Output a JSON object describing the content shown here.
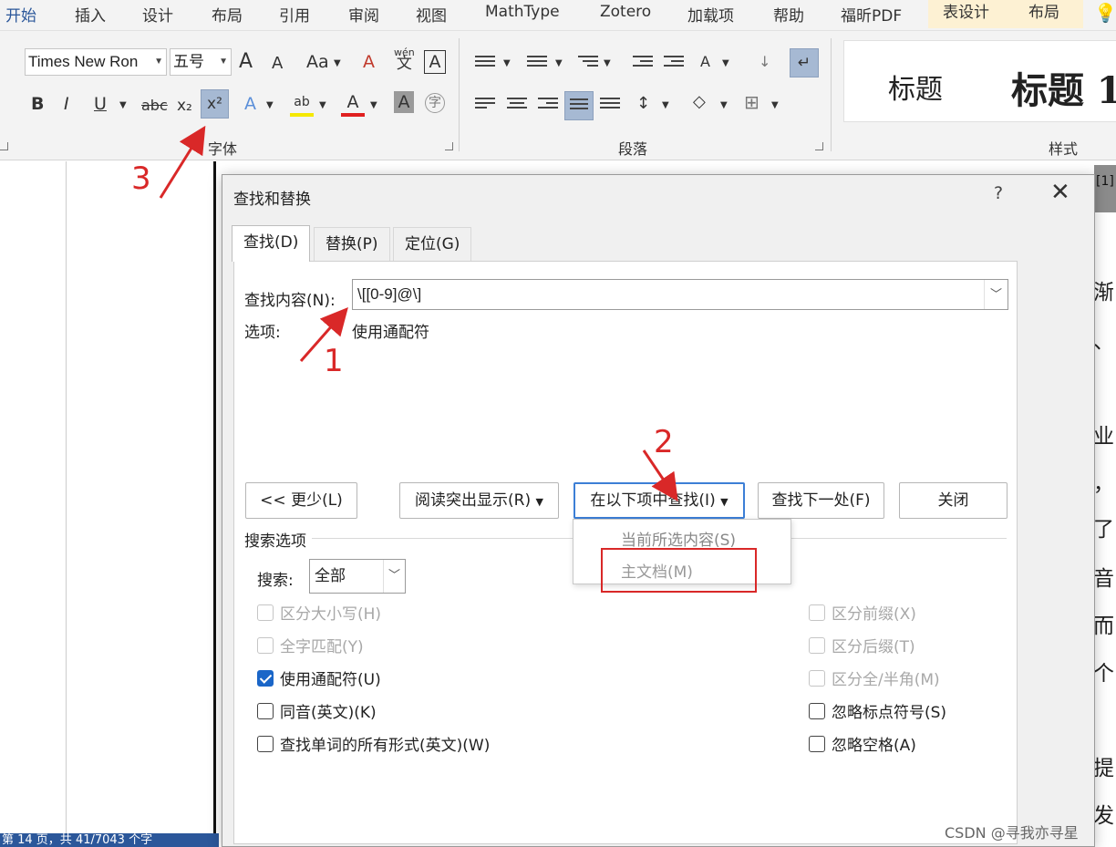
{
  "ribbon": {
    "tabs": [
      "开始",
      "插入",
      "设计",
      "布局",
      "引用",
      "审阅",
      "视图",
      "MathType",
      "Zotero",
      "加载项",
      "帮助",
      "福昕PDF",
      "表设计",
      "布局"
    ],
    "font_name": "Times New Ron",
    "font_size": "五号",
    "group_font": "字体",
    "group_paragraph": "段落",
    "group_styles": "样式",
    "styles": [
      "标题",
      "标题 1"
    ],
    "font_buttons": {
      "bold": "B",
      "italic": "I",
      "underline": "U",
      "strike": "abc",
      "subscript": "x₂",
      "superscript": "x²",
      "grow": "A",
      "shrink": "A",
      "case": "Aa",
      "clear": "A",
      "pinyin_top": "wén",
      "pinyin_bottom": "文",
      "border": "A"
    }
  },
  "document": {
    "right_chars": [
      "[1]",
      "渐",
      "、",
      "业",
      "，",
      "了",
      "音",
      "而",
      "个",
      "提",
      "发"
    ],
    "status_text": "第 14 页，共 41/7043 个字"
  },
  "dialog": {
    "title": "查找和替换",
    "help": "?",
    "close": "✕",
    "tabs": [
      "查找(D)",
      "替换(P)",
      "定位(G)"
    ],
    "find_label": "查找内容(N):",
    "find_value": "\\[[0-9]@\\]",
    "options_label": "选项:",
    "options_value": "使用通配符",
    "buttons": {
      "less": "<< 更少(L)",
      "reading_highlight": "阅读突出显示(R)",
      "find_in": "在以下项中查找(I)",
      "find_next": "查找下一处(F)",
      "close": "关闭"
    },
    "search_options_label": "搜索选项",
    "search_label": "搜索:",
    "search_value": "全部",
    "left_options": [
      {
        "label": "区分大小写(H)",
        "checked": false,
        "enabled": false
      },
      {
        "label": "全字匹配(Y)",
        "checked": false,
        "enabled": false
      },
      {
        "label": "使用通配符(U)",
        "checked": true,
        "enabled": true
      },
      {
        "label": "同音(英文)(K)",
        "checked": false,
        "enabled": true
      },
      {
        "label": "查找单词的所有形式(英文)(W)",
        "checked": false,
        "enabled": true
      }
    ],
    "right_options": [
      {
        "label": "区分前缀(X)",
        "checked": false,
        "enabled": false
      },
      {
        "label": "区分后缀(T)",
        "checked": false,
        "enabled": false
      },
      {
        "label": "区分全/半角(M)",
        "checked": false,
        "enabled": false
      },
      {
        "label": "忽略标点符号(S)",
        "checked": false,
        "enabled": true
      },
      {
        "label": "忽略空格(A)",
        "checked": false,
        "enabled": true
      }
    ],
    "menu_items": [
      "当前所选内容(S)",
      "主文档(M)"
    ]
  },
  "annotations": [
    "1",
    "2",
    "3"
  ],
  "watermark": "CSDN @寻我亦寻星",
  "colors": {
    "accent": "#2b579a",
    "annotation": "#d92828",
    "checkbox": "#1a66c8"
  }
}
